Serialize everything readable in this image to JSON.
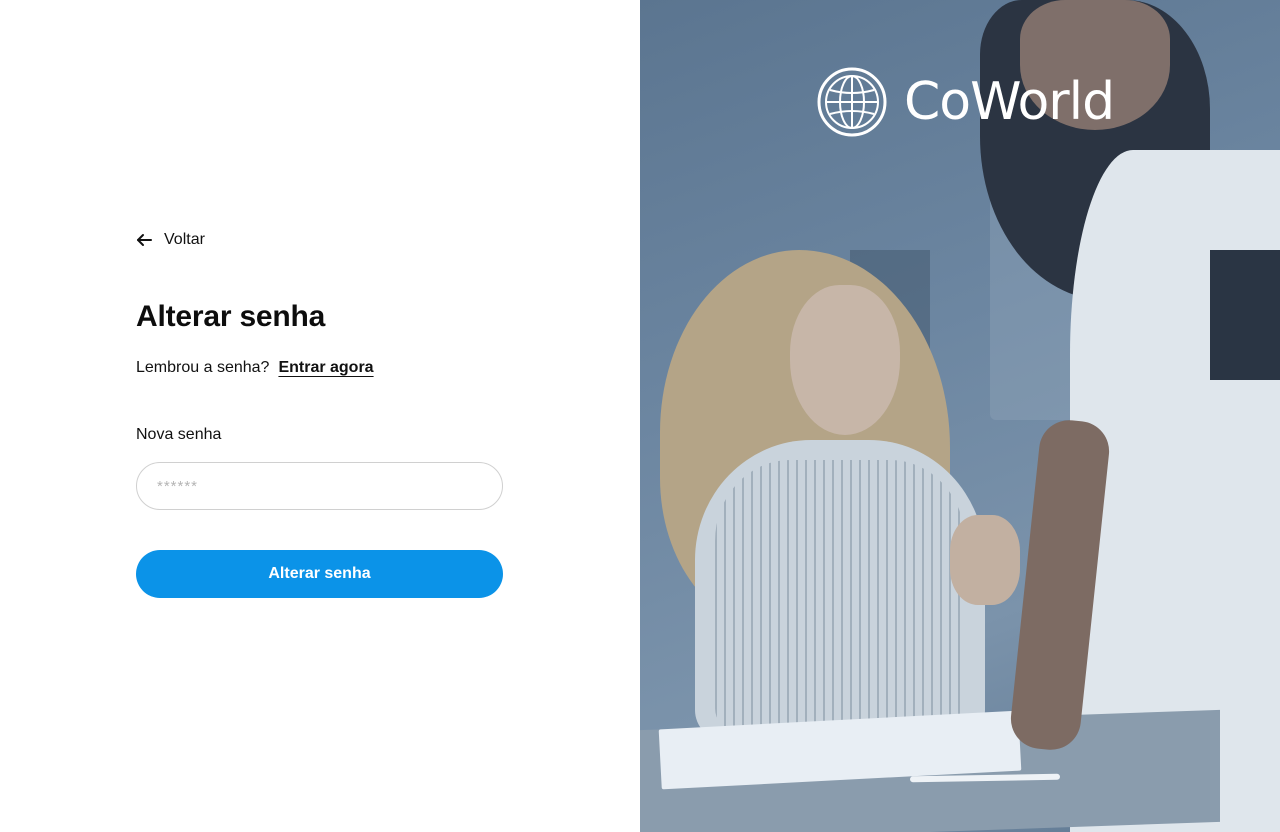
{
  "back": {
    "label": "Voltar"
  },
  "form": {
    "title": "Alterar senha",
    "remember_text": "Lembrou a senha?",
    "login_link": "Entrar agora",
    "password_label": "Nova senha",
    "password_placeholder": "******",
    "submit_label": "Alterar senha"
  },
  "brand": {
    "name": "CoWorld",
    "logo_icon": "globe-icon"
  },
  "colors": {
    "primary": "#0b93e8",
    "overlay": "#6c86a1"
  }
}
